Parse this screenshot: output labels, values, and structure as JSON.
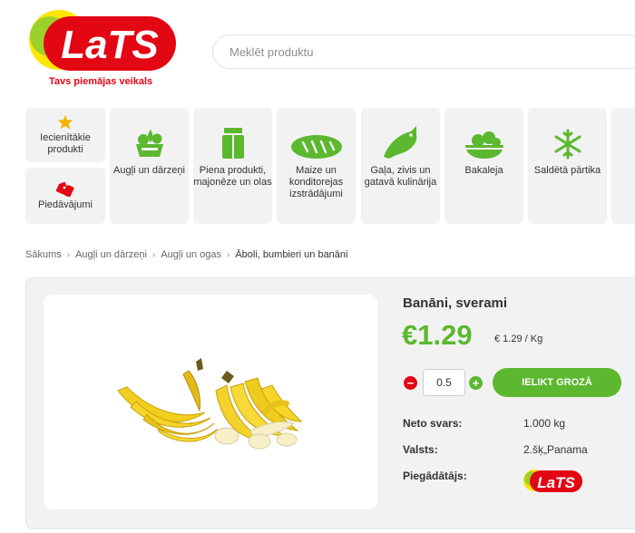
{
  "header": {
    "logo_text": "LaTS",
    "tagline": "Tavs piemājas veikals",
    "search_placeholder": "Meklēt produktu"
  },
  "categories": [
    {
      "label": "Iecienītākie produkti",
      "icon": "star-icon"
    },
    {
      "label": "Piedāvājumi",
      "icon": "price-tag-icon"
    },
    {
      "label": "Augļi un dārzeņi",
      "icon": "vegetables-icon"
    },
    {
      "label": "Piena produkti, majonēze un olas",
      "icon": "milk-carton-icon"
    },
    {
      "label": "Maize un konditorejas izstrādājumi",
      "icon": "bread-icon"
    },
    {
      "label": "Gaļa, zivis un gatavā kulinārija",
      "icon": "fish-icon"
    },
    {
      "label": "Bakaleja",
      "icon": "grocery-bowl-icon"
    },
    {
      "label": "Saldētā pārtika",
      "icon": "snowflake-icon"
    }
  ],
  "breadcrumb": [
    "Sākums",
    "Augļi un dārzeņi",
    "Augļi un ogas",
    "Āboli, bumbieri un banāni"
  ],
  "product": {
    "title": "Banāni, sverami",
    "price": "€1.29",
    "unit_price": "€ 1.29 / Kg",
    "quantity": "0.5",
    "add_to_cart": "IELIKT GROZĀ",
    "details": [
      {
        "label": "Neto svars:",
        "value": "1.000 kg"
      },
      {
        "label": "Valsts:",
        "value": "2.šķ„Panama"
      },
      {
        "label": "Piegādātājs:",
        "value": ""
      }
    ],
    "supplier_logo_text": "LaTS"
  },
  "colors": {
    "brand_red": "#e30613",
    "brand_yellow": "#ffe600",
    "brand_green": "#5cb82e",
    "panel_grey": "#f2f2f2"
  }
}
